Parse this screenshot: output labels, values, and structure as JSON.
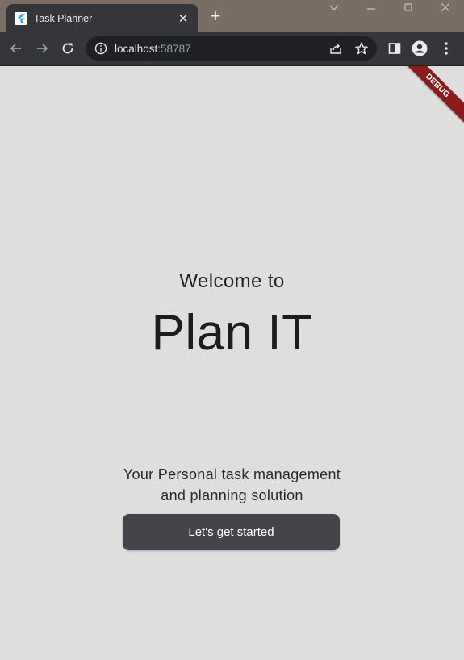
{
  "browser": {
    "tab_title": "Task Planner",
    "url_host": "localhost",
    "url_port": ":58787",
    "new_tab_symbol": "+",
    "close_symbol": "✕"
  },
  "page": {
    "debug_banner": "DEBUG",
    "welcome": "Welcome to",
    "brand": "Plan IT",
    "tagline_line1": "Your Personal task management",
    "tagline_line2": "and planning solution",
    "cta_label": "Let's get started"
  },
  "colors": {
    "page_bg": "#dedede",
    "button_bg": "#46434b",
    "debug_banner": "#8b1c1c",
    "toolbar_bg": "#35363a"
  }
}
